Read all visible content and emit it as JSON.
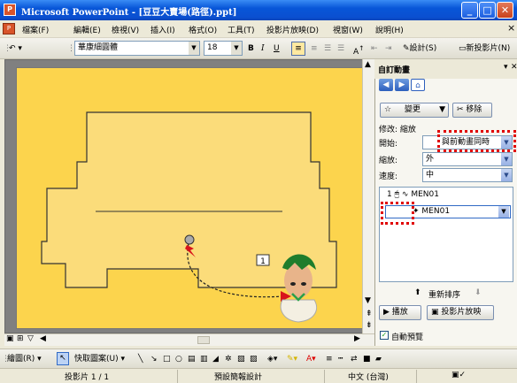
{
  "window": {
    "title": "Microsoft PowerPoint - [豆豆大賣場(路徑).ppt]",
    "minimize": "_",
    "maximize": "□",
    "close": "✕"
  },
  "menu": [
    "檔案(F)",
    "編輯(E)",
    "檢視(V)",
    "插入(I)",
    "格式(O)",
    "工具(T)",
    "投影片放映(D)",
    "視窗(W)",
    "說明(H)"
  ],
  "menu_close": "×",
  "toolbar": {
    "font": "華康細圓體",
    "size": "18",
    "bold": "B",
    "italic": "I",
    "underline": "U",
    "design": "設計(S)",
    "new_slide": "新投影片(N)"
  },
  "slide": {
    "motion_tag": "1",
    "palette": {
      "background": "#fcd44d",
      "shape": "#fbdc7a",
      "outline": "#333333"
    }
  },
  "task_pane": {
    "title": "自訂動畫",
    "change_button": "變更",
    "remove_button": "移除",
    "modify_label": "修改: 縮放",
    "start_label": "開始:",
    "start_value": "與前動畫同時",
    "zoom_label": "縮放:",
    "zoom_value": "外",
    "speed_label": "速度:",
    "speed_value": "中",
    "list_items": [
      {
        "number": "1",
        "name": "MEN01"
      },
      {
        "number": "",
        "name": "MEN01"
      }
    ],
    "reorder_label": "重新排序",
    "play_button": "播放",
    "slideshow_button": "投影片放映",
    "autopreview_label": "自動預覽"
  },
  "drawing_toolbar": {
    "draw": "繪圖(R)",
    "autoshapes": "快取圖案(U)"
  },
  "status": {
    "slide": "投影片 1 / 1",
    "design": "預設簡報設計",
    "language": "中文 (台灣)"
  }
}
